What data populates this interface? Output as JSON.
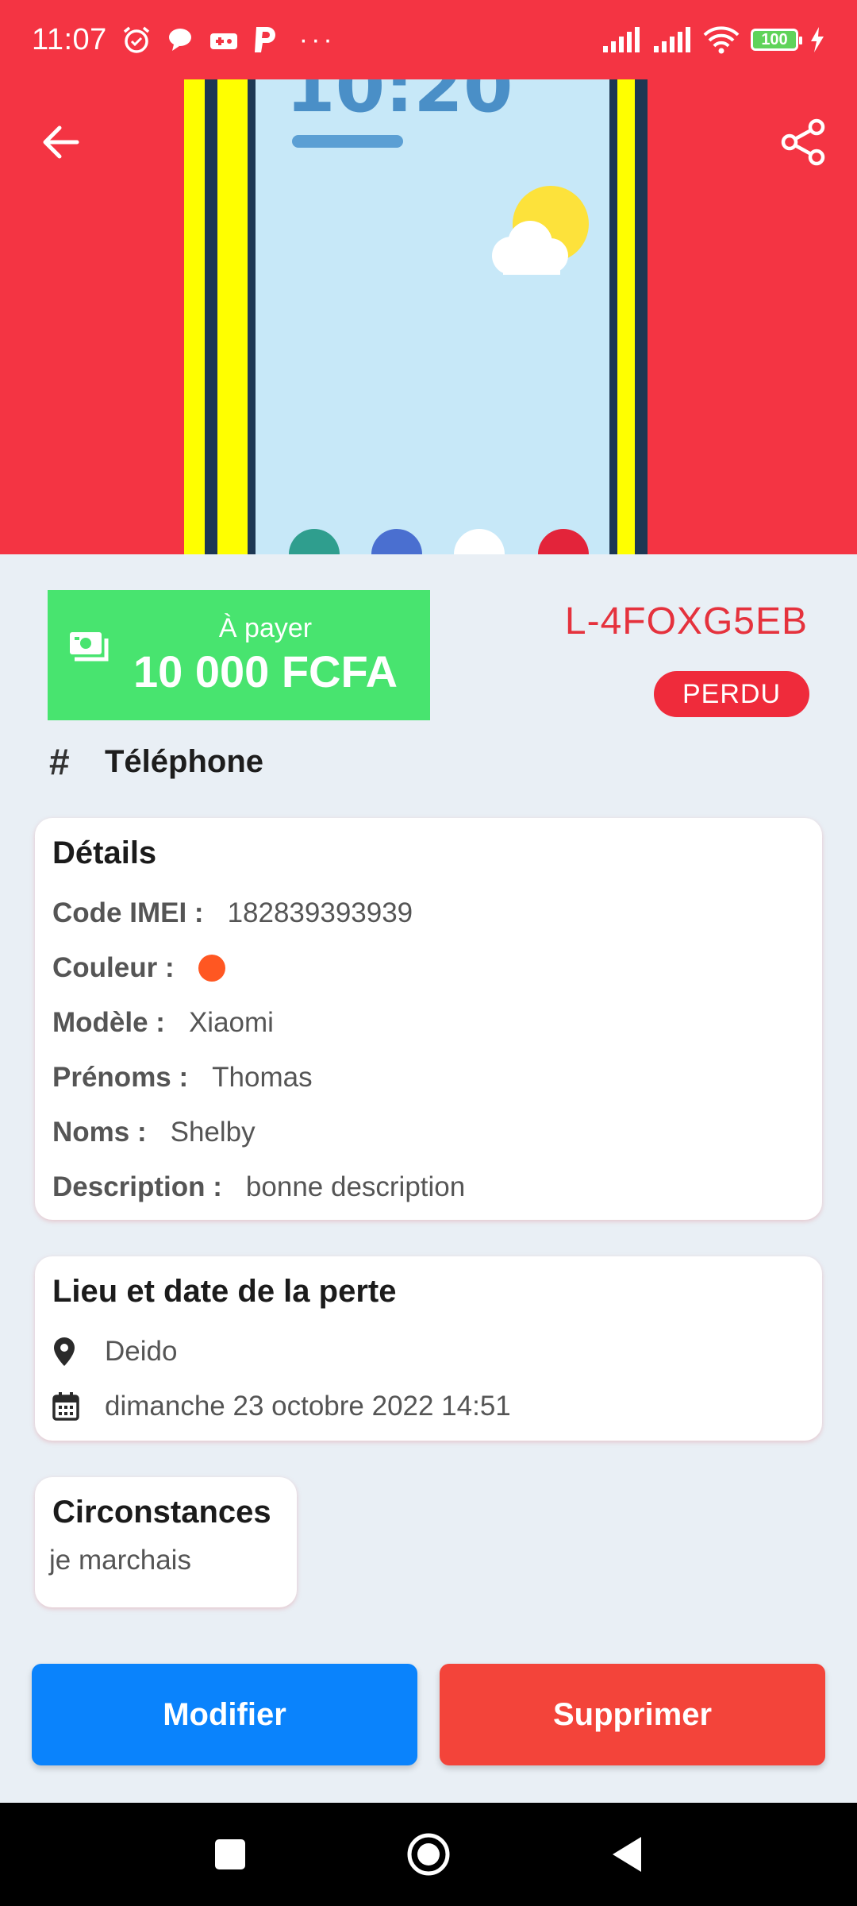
{
  "status_bar": {
    "time": "11:07",
    "dots": "···",
    "battery": "100",
    "icons": [
      "alarm-icon",
      "chat-icon",
      "game-icon",
      "paypal-icon",
      "signal-icon",
      "signal-icon",
      "wifi-icon",
      "battery-icon",
      "charging-icon"
    ]
  },
  "header": {
    "back_icon": "arrow-left-icon",
    "share_icon": "share-icon",
    "colors": {
      "background": "#f43443"
    }
  },
  "payment": {
    "label": "À payer",
    "amount": "10 000 FCFA",
    "icon": "money-icon",
    "color": "#48e46f"
  },
  "reference": "L-4FOXG5EB",
  "status": "PERDU",
  "category": {
    "symbol": "#",
    "label": "Téléphone"
  },
  "details": {
    "title": "Détails",
    "imei_label": "Code IMEI :",
    "imei_value": "182839393939",
    "color_label": "Couleur :",
    "color_value": "#ff5722",
    "model_label": "Modèle :",
    "model_value": "Xiaomi",
    "firstname_label": "Prénoms :",
    "firstname_value": "Thomas",
    "lastname_label": "Noms :",
    "lastname_value": "Shelby",
    "description_label": "Description :",
    "description_value": "bonne description"
  },
  "loss": {
    "title": "Lieu et date de la perte",
    "place": "Deido",
    "date": "dimanche 23 octobre 2022 14:51",
    "place_icon": "map-pin-icon",
    "date_icon": "calendar-icon"
  },
  "circumstances": {
    "title": "Circonstances",
    "text": "je marchais"
  },
  "actions": {
    "edit_label": "Modifier",
    "delete_label": "Supprimer",
    "edit_color": "#0a83fc",
    "delete_color": "#f3443a"
  },
  "nav": {
    "icons": [
      "recents-square-icon",
      "home-circle-icon",
      "back-triangle-icon"
    ]
  }
}
